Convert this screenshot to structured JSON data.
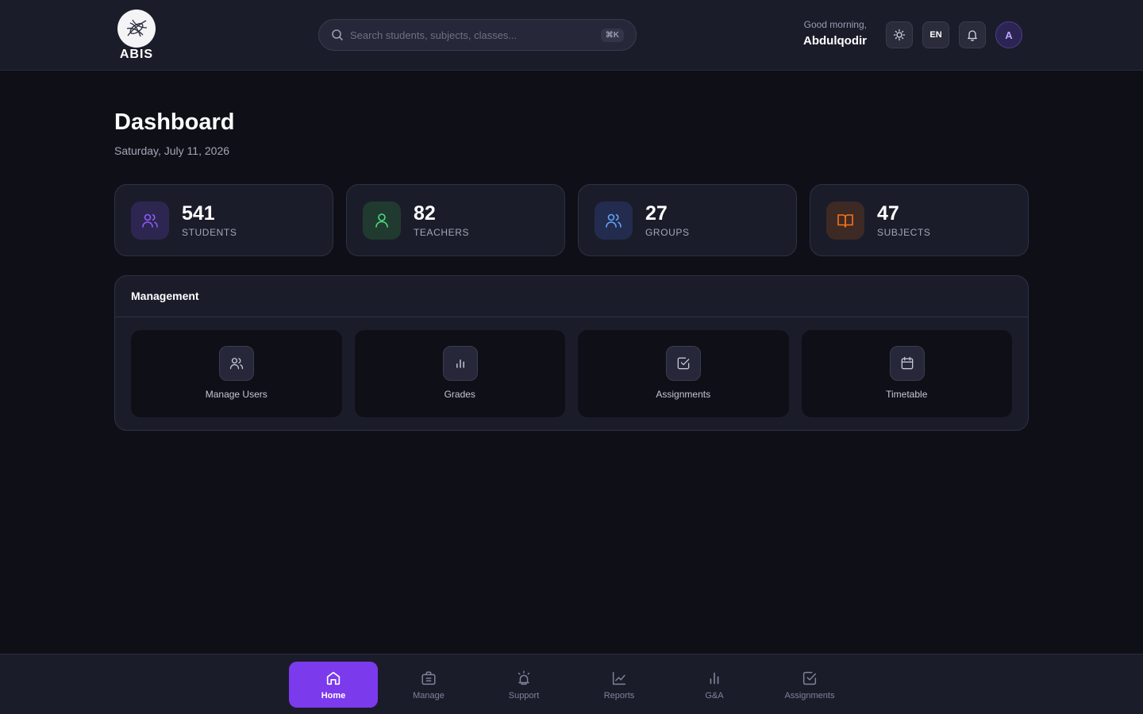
{
  "header": {
    "logo_text": "ABIS",
    "search_placeholder": "Search students, subjects, classes...",
    "search_shortcut": "⌘K",
    "greeting": "Good morning,",
    "user_name": "Abdulqodir",
    "language": "EN",
    "avatar_initial": "A"
  },
  "page": {
    "title": "Dashboard",
    "date": "Saturday, July 11, 2026"
  },
  "stats": [
    {
      "value": "541",
      "label": "STUDENTS",
      "icon": "users-icon",
      "color": "#8b5cf6",
      "bg": "#2d2650"
    },
    {
      "value": "82",
      "label": "TEACHERS",
      "icon": "user-icon",
      "color": "#4ade80",
      "bg": "#213a2f"
    },
    {
      "value": "27",
      "label": "GROUPS",
      "icon": "users-icon",
      "color": "#60a5fa",
      "bg": "#232c4e"
    },
    {
      "value": "47",
      "label": "SUBJECTS",
      "icon": "book-open-icon",
      "color": "#f97316",
      "bg": "#3d2a25"
    }
  ],
  "management": {
    "title": "Management",
    "tiles": [
      {
        "label": "Manage Users",
        "icon": "users-icon"
      },
      {
        "label": "Grades",
        "icon": "bar-chart-icon"
      },
      {
        "label": "Assignments",
        "icon": "check-square-icon"
      },
      {
        "label": "Timetable",
        "icon": "calendar-icon"
      }
    ]
  },
  "bottom_nav": [
    {
      "label": "Home",
      "icon": "home-icon",
      "active": true
    },
    {
      "label": "Manage",
      "icon": "briefcase-icon",
      "active": false
    },
    {
      "label": "Support",
      "icon": "alarm-icon",
      "active": false
    },
    {
      "label": "Reports",
      "icon": "line-chart-icon",
      "active": false
    },
    {
      "label": "G&A",
      "icon": "bar-chart-icon",
      "active": false
    },
    {
      "label": "Assignments",
      "icon": "check-square-icon",
      "active": false
    }
  ],
  "colors": {
    "accent": "#7c3aed",
    "background": "#0f1017",
    "surface": "#1b1c2a"
  }
}
